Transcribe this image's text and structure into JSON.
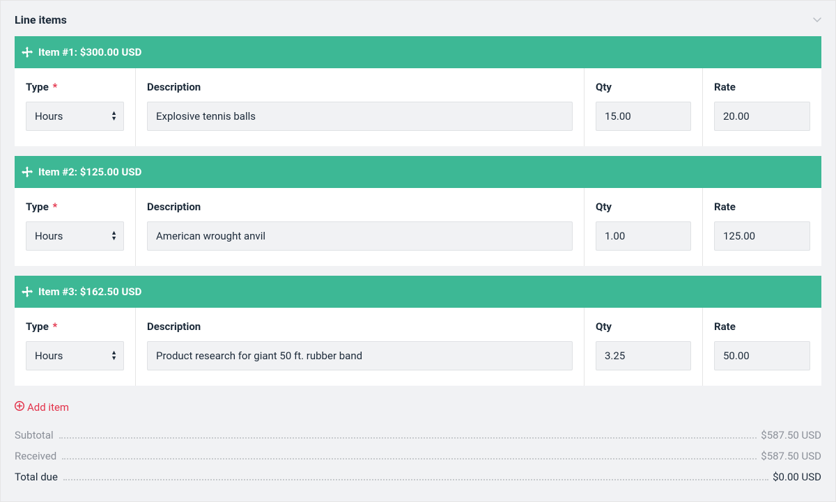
{
  "panel": {
    "title": "Line items"
  },
  "labels": {
    "type": "Type",
    "description": "Description",
    "qty": "Qty",
    "rate": "Rate",
    "required": "*"
  },
  "type_option": "Hours",
  "items": [
    {
      "header": "Item #1: $300.00 USD",
      "type": "Hours",
      "description": "Explosive tennis balls",
      "qty": "15.00",
      "rate": "20.00"
    },
    {
      "header": "Item #2: $125.00 USD",
      "type": "Hours",
      "description": "American wrought anvil",
      "qty": "1.00",
      "rate": "125.00"
    },
    {
      "header": "Item #3: $162.50 USD",
      "type": "Hours",
      "description": "Product research for giant 50 ft. rubber band",
      "qty": "3.25",
      "rate": "50.00"
    }
  ],
  "add_item_label": "Add item",
  "totals": {
    "subtotal_label": "Subtotal",
    "subtotal_value": "$587.50 USD",
    "received_label": "Received",
    "received_value": "$587.50 USD",
    "due_label": "Total due",
    "due_value": "$0.00 USD"
  }
}
